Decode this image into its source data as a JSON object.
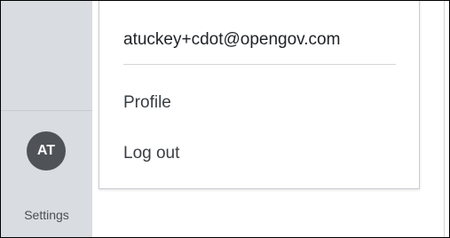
{
  "user": {
    "email": "atuckey+cdot@opengov.com",
    "initials": "AT"
  },
  "menu": {
    "profile_label": "Profile",
    "logout_label": "Log out"
  },
  "sidebar": {
    "settings_label": "Settings"
  },
  "colors": {
    "sidebar_bg": "#d9dde2",
    "avatar_bg": "#4f5257",
    "text_primary": "#1f2226",
    "text_secondary": "#3a3e43"
  }
}
